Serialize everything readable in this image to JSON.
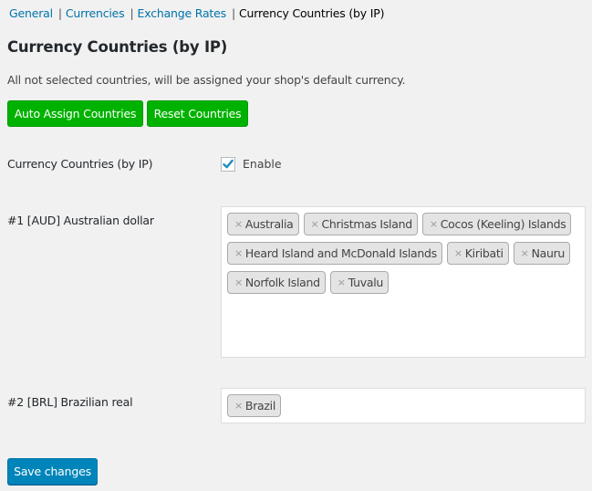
{
  "subnav": {
    "items": [
      {
        "label": "General"
      },
      {
        "label": "Currencies"
      },
      {
        "label": "Exchange Rates"
      },
      {
        "label": "Currency Countries (by IP)",
        "current": true
      }
    ],
    "separator": "|"
  },
  "page": {
    "title": "Currency Countries (by IP)",
    "description": "All not selected countries, will be assigned your shop's default currency."
  },
  "actions": {
    "auto_assign_label": "Auto Assign Countries",
    "reset_label": "Reset Countries"
  },
  "settings": {
    "enable_row": {
      "label": "Currency Countries (by IP)",
      "checkbox_label": "Enable",
      "checked": true
    },
    "currencies": [
      {
        "label": "#1 [AUD] Australian dollar",
        "countries": [
          "Australia",
          "Christmas Island",
          "Cocos (Keeling) Islands",
          "Heard Island and McDonald Islands",
          "Kiribati",
          "Nauru",
          "Norfolk Island",
          "Tuvalu"
        ]
      },
      {
        "label": "#2 [BRL] Brazilian real",
        "countries": [
          "Brazil"
        ]
      }
    ]
  },
  "remove_glyph": "×",
  "save_label": "Save changes",
  "colors": {
    "link": "#0073aa",
    "green_button": "#00b200",
    "primary_button": "#0085ba",
    "checkmark": "#1e8cbe"
  }
}
